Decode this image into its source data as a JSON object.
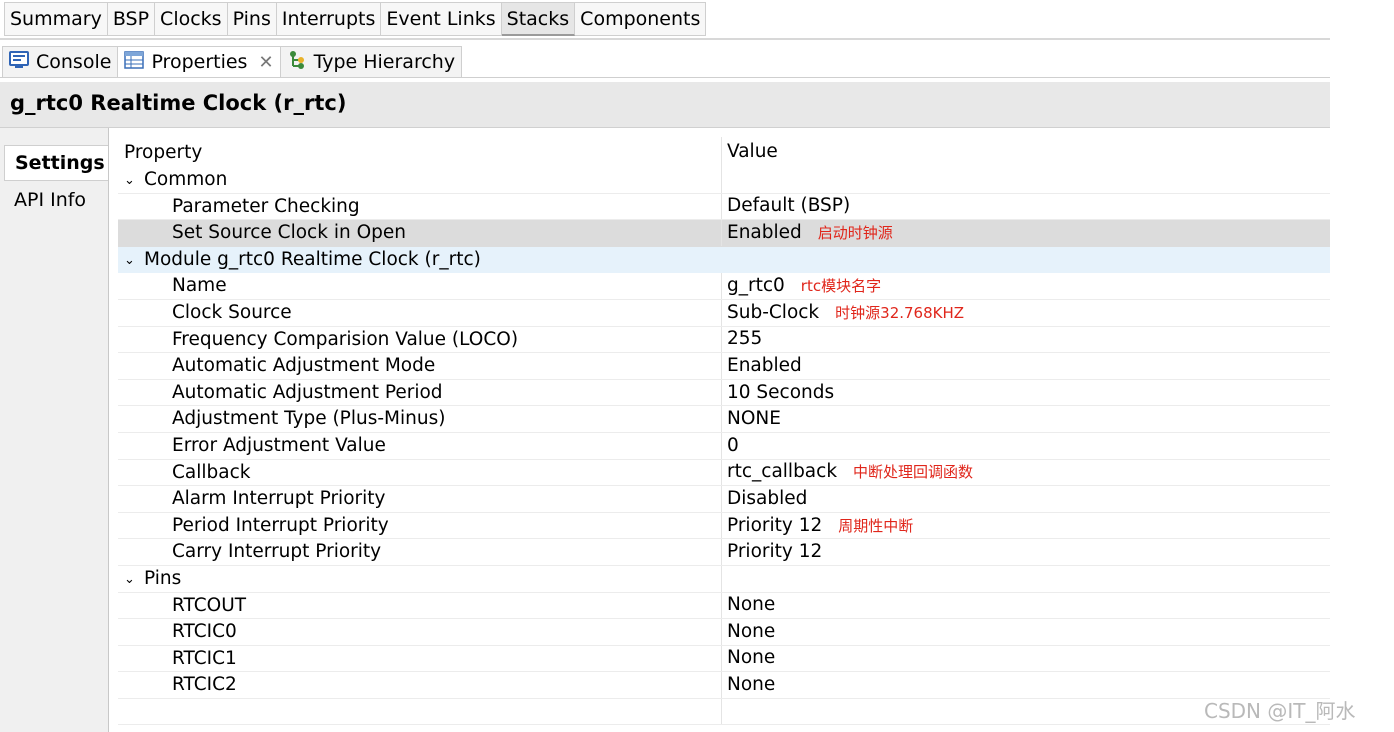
{
  "config_tabs": [
    "Summary",
    "BSP",
    "Clocks",
    "Pins",
    "Interrupts",
    "Event Links",
    "Stacks",
    "Components"
  ],
  "view_tabs": {
    "console": "Console",
    "properties": "Properties",
    "type_hierarchy": "Type Hierarchy"
  },
  "title": "g_rtc0 Realtime Clock (r_rtc)",
  "left_tabs": {
    "settings": "Settings",
    "api_info": "API Info"
  },
  "table": {
    "header_property": "Property",
    "header_value": "Value",
    "common": {
      "label": "Common",
      "rows": [
        {
          "prop": "Parameter Checking",
          "value": "Default (BSP)",
          "note": ""
        },
        {
          "prop": "Set Source Clock in Open",
          "value": "Enabled",
          "note": "启动时钟源"
        }
      ]
    },
    "module": {
      "label": "Module g_rtc0 Realtime Clock (r_rtc)",
      "rows": [
        {
          "prop": "Name",
          "value": "g_rtc0",
          "note": "rtc模块名字"
        },
        {
          "prop": "Clock Source",
          "value": "Sub-Clock",
          "note": "时钟源32.768KHZ"
        },
        {
          "prop": "Frequency Comparision Value (LOCO)",
          "value": "255",
          "note": ""
        },
        {
          "prop": "Automatic Adjustment Mode",
          "value": "Enabled",
          "note": ""
        },
        {
          "prop": "Automatic Adjustment Period",
          "value": "10 Seconds",
          "note": ""
        },
        {
          "prop": "Adjustment Type (Plus-Minus)",
          "value": "NONE",
          "note": ""
        },
        {
          "prop": "Error Adjustment Value",
          "value": "0",
          "note": ""
        },
        {
          "prop": "Callback",
          "value": "rtc_callback",
          "note": "中断处理回调函数"
        },
        {
          "prop": "Alarm Interrupt Priority",
          "value": "Disabled",
          "note": ""
        },
        {
          "prop": "Period Interrupt Priority",
          "value": "Priority 12",
          "note": "周期性中断"
        },
        {
          "prop": "Carry Interrupt Priority",
          "value": "Priority 12",
          "note": ""
        }
      ]
    },
    "pins": {
      "label": "Pins",
      "rows": [
        {
          "prop": "RTCOUT",
          "value": "None",
          "note": ""
        },
        {
          "prop": "RTCIC0",
          "value": "None",
          "note": ""
        },
        {
          "prop": "RTCIC1",
          "value": "None",
          "note": ""
        },
        {
          "prop": "RTCIC2",
          "value": "None",
          "note": ""
        }
      ]
    }
  },
  "watermark": "CSDN @IT_阿水",
  "colors": {
    "annotation": "#e0261b",
    "selected_row": "#dcdcdc",
    "module_row": "#e6f2fb"
  },
  "icons": [
    "console-icon",
    "properties-icon",
    "close-icon",
    "type-hierarchy-icon",
    "chevron-down-icon"
  ]
}
